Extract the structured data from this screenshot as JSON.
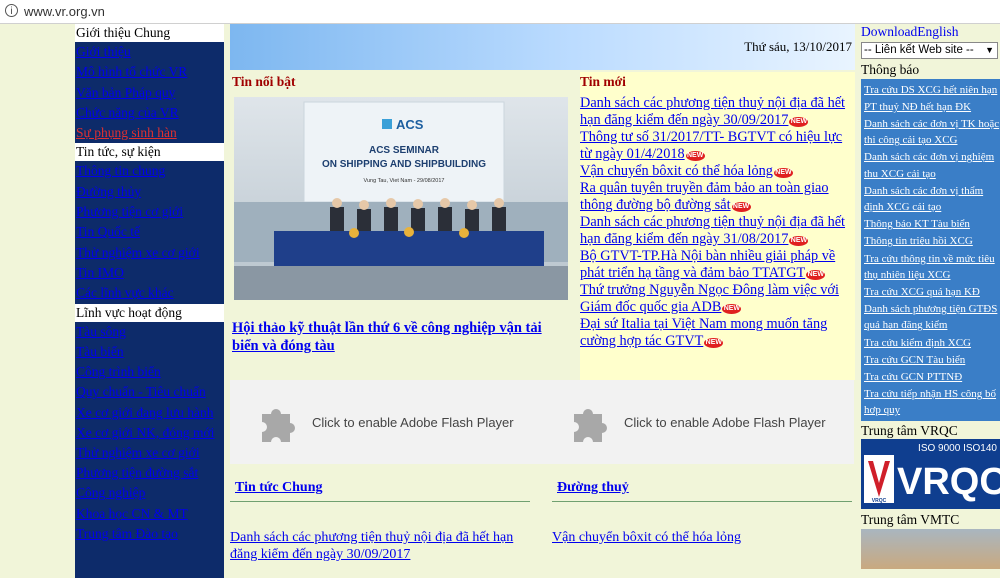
{
  "browser": {
    "url": "www.vr.org.vn"
  },
  "left_nav": {
    "sections": [
      {
        "title": "Giới thiệu Chung",
        "items": [
          {
            "label": "Giới thiệu"
          },
          {
            "label": "Mô hình tổ chức VR"
          },
          {
            "label": "Văn bản Pháp quy"
          },
          {
            "label": "Chức năng của VR"
          },
          {
            "label": "Sự phụng sinh hàn"
          }
        ]
      },
      {
        "title": "Tin tức, sự kiện",
        "items": [
          {
            "label": "Thông tin chung"
          },
          {
            "label": "Đường thủy"
          },
          {
            "label": "Phương tiện cơ giới"
          },
          {
            "label": "Tin Quốc tế"
          },
          {
            "label": "Thử nghiệm xe cơ giới"
          },
          {
            "label": "Tin IMO"
          },
          {
            "label": "Các lĩnh vực khác"
          }
        ]
      },
      {
        "title": "Lĩnh vực hoạt động",
        "items": [
          {
            "label": "Tàu sông"
          },
          {
            "label": "Tàu biển"
          },
          {
            "label": "Công trình biển"
          },
          {
            "label": "Quy chuẩn - Tiêu chuẩn"
          },
          {
            "label": "Xe cơ giới đang lưu hành"
          },
          {
            "label": "Xe cơ giới NK, đóng mới"
          },
          {
            "label": "Thử nghiệm xe cơ giới"
          },
          {
            "label": "Phương tiện đường sắt"
          },
          {
            "label": "Công nghiệp"
          },
          {
            "label": "Khoa học CN & MT"
          },
          {
            "label": "Trung tâm Đào tạo"
          }
        ]
      }
    ]
  },
  "header": {
    "date": "Thứ sáu, 13/10/2017"
  },
  "highlight": {
    "title": "Tin nổi bật",
    "photo_logo": "ACS",
    "photo_heading_1": "ACS SEMINAR",
    "photo_heading_2": "ON SHIPPING AND SHIPBUILDING",
    "photo_caption": "Vung Tau, Viet Nam - 29/08/2017",
    "link": "Hội thảo kỹ thuật lần thứ 6 về công nghiệp vận tải biển và đóng tàu"
  },
  "latest_news": {
    "title": "Tin mới",
    "new_badge": "NEW",
    "items": [
      {
        "text": "Danh sách các phương tiện thuỷ nội địa đã hết hạn đăng kiểm đến ngày 30/09/2017"
      },
      {
        "text": "Thông tư số 31/2017/TT- BGTVT có hiệu lực từ ngày 01/4/2018"
      },
      {
        "text": "Vận chuyển bôxit có thể hóa lỏng"
      },
      {
        "text": "Ra quân tuyên truyền đảm bảo an toàn giao thông đường bộ đường sắt"
      },
      {
        "text": "Danh sách các phương tiện thuỷ nội địa đã hết hạn đăng kiểm đến ngày 31/08/2017"
      },
      {
        "text": "Bộ GTVT-TP.Hà Nội bàn nhiều giải pháp về phát triển hạ tầng và đảm bảo TTATGT"
      },
      {
        "text": "Thứ trưởng Nguyễn Ngọc Đông làm việc với Giám đốc quốc gia ADB"
      },
      {
        "text": "Đại sứ Italia tại Việt Nam mong muốn tăng cường hợp tác GTVT"
      }
    ]
  },
  "flash": {
    "label": "Click to enable Adobe Flash Player"
  },
  "columns": [
    {
      "title": "Tin tức Chung",
      "link": "Danh sách các phương tiện thuỷ nội địa đã hết hạn đăng kiểm đến ngày 30/09/2017"
    },
    {
      "title": "Đường thuỷ",
      "link": "Vận chuyển bôxit có thể hóa lỏng"
    }
  ],
  "right_sidebar": {
    "download": "Download",
    "english": "English",
    "select_value": "-- Liên kết Web site --",
    "notice_title": "Thông báo",
    "notices": [
      {
        "text": "Tra cứu DS XCG hết niên hạn"
      },
      {
        "text": "PT thuỷ NĐ hết hạn ĐK"
      },
      {
        "text": "Danh sách các đơn vị TK hoặc thi công cải tạo XCG"
      },
      {
        "text": "Danh sách các đơn vị nghiệm thu XCG cải tạo"
      },
      {
        "text": "Danh sách các đơn vị thẩm định XCG cải tạo"
      },
      {
        "text": "Thông báo KT Tàu biển"
      },
      {
        "text": "Thông tin triệu hồi XCG"
      },
      {
        "text": "Tra cứu thông tin về mức tiêu thụ nhiên liệu XCG"
      },
      {
        "text": "Tra cứu XCG quá hạn KĐ"
      },
      {
        "text": "Danh sách phương tiện GTĐS quá hạn đăng kiểm"
      },
      {
        "text": "Tra cứu kiểm định XCG"
      },
      {
        "text": "Tra cứu GCN Tàu biển"
      },
      {
        "text": "Tra cứu GCN PTTNĐ"
      },
      {
        "text": "Tra cứu tiếp nhận HS công bố hợp quy"
      }
    ],
    "vrqc_title": "Trung tâm VRQC",
    "vrqc_iso": "ISO 9000 ISO140",
    "vrqc_logo": "VRQC",
    "vrqc_small": "VRQC",
    "vmtc_title": "Trung tâm VMTC"
  }
}
